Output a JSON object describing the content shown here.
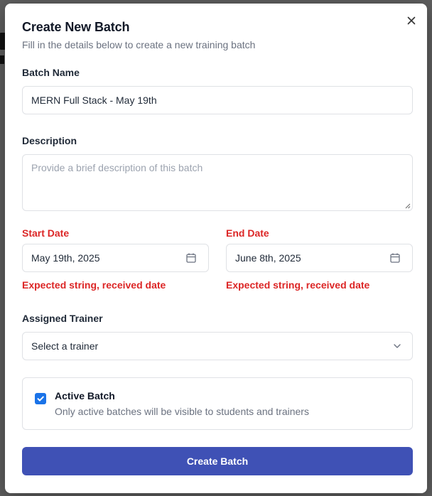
{
  "dialog": {
    "title": "Create New Batch",
    "subtitle": "Fill in the details below to create a new training batch",
    "close_icon": "close-icon"
  },
  "form": {
    "batch_name": {
      "label": "Batch Name",
      "value": "MERN Full Stack - May 19th"
    },
    "description": {
      "label": "Description",
      "placeholder": "Provide a brief description of this batch"
    },
    "start_date": {
      "label": "Start Date",
      "value": "May 19th, 2025",
      "error": "Expected string, received date",
      "icon": "calendar-icon"
    },
    "end_date": {
      "label": "End Date",
      "value": "June 8th, 2025",
      "error": "Expected string, received date",
      "icon": "calendar-icon"
    },
    "trainer": {
      "label": "Assigned Trainer",
      "selected": "Select a trainer",
      "icon": "chevron-down-icon"
    },
    "active": {
      "title": "Active Batch",
      "description": "Only active batches will be visible to students and trainers",
      "checked": true
    },
    "submit_label": "Create Batch"
  },
  "colors": {
    "primary": "#3f51b5",
    "error": "#dc2626",
    "checkbox": "#1a73e8"
  }
}
